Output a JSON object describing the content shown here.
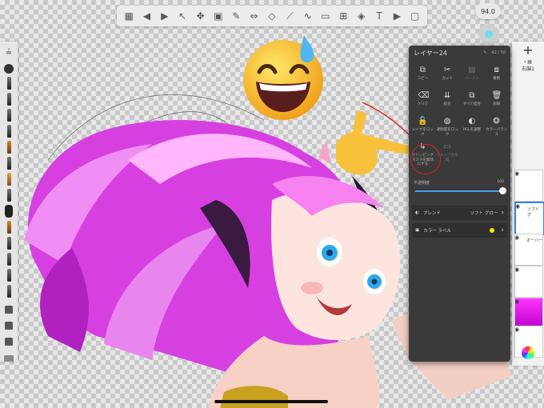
{
  "layer_panel": {
    "title": "レイヤー24",
    "count": "42 / 50",
    "actions": [
      {
        "label": "コピー",
        "icon": "copy-icon",
        "enabled": true
      },
      {
        "label": "カット",
        "icon": "scissors-icon",
        "enabled": true
      },
      {
        "label": "ペースト",
        "icon": "paste-icon",
        "enabled": false
      },
      {
        "label": "複製",
        "icon": "duplicate-icon",
        "enabled": true
      },
      {
        "label": "クリア",
        "icon": "clear-icon",
        "enabled": true
      },
      {
        "label": "結合",
        "icon": "merge-icon",
        "enabled": true
      },
      {
        "label": "すべて結合",
        "icon": "merge-all-icon",
        "enabled": true
      },
      {
        "label": "削除",
        "icon": "trash-icon",
        "enabled": true
      },
      {
        "label": "レイヤをロック",
        "icon": "lock-icon",
        "enabled": true
      },
      {
        "label": "透明度をロック",
        "icon": "transparency-lock-icon",
        "enabled": true
      },
      {
        "label": "HSLを調整",
        "icon": "hsl-icon",
        "enabled": true
      },
      {
        "label": "カラーバランス",
        "icon": "color-balance-icon",
        "enabled": true
      },
      {
        "label": "クリッピングマスクを無効にする",
        "icon": "clipping-mask-icon",
        "enabled": true
      },
      {
        "label": "グループを作成",
        "icon": "folder-icon",
        "enabled": false
      }
    ],
    "opacity_label": "不透明度",
    "opacity_value": "100",
    "opacity_fraction": 1.0,
    "blend_label": "ブレンド",
    "blend_value": "ソフト グロー",
    "color_label_text": "カラー ラベル",
    "color_label_color": "#ffe900"
  },
  "brush_size": {
    "value": "94.0"
  },
  "right_strip": {
    "back_label": "右脳1",
    "layers": [
      {
        "label": "",
        "visible": true
      },
      {
        "label": "ソフト グ",
        "visible": true,
        "selected": true
      },
      {
        "label": "オーバー",
        "visible": true
      },
      {
        "label": "",
        "visible": true
      },
      {
        "label": "",
        "visible": true
      },
      {
        "label": "",
        "visible": true
      }
    ]
  },
  "colors": {
    "accent": "#2e8ce6",
    "panel_bg": "#3a3a3a",
    "annotation": "#e02020",
    "hair": "#e040e8"
  }
}
